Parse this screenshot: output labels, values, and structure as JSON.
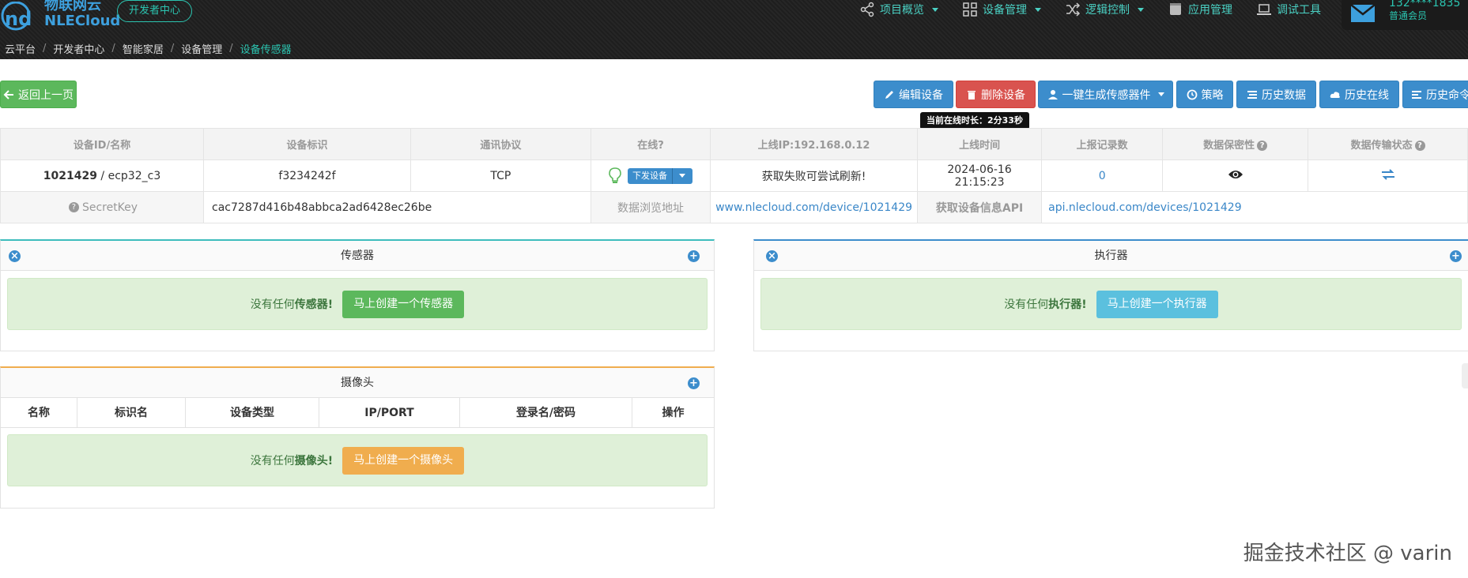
{
  "brand": {
    "name_cn": "物联网云",
    "name_en": "NLECloud",
    "dev_center": "开发者中心"
  },
  "nav": [
    {
      "label": "项目概览",
      "icon": "share-icon",
      "dropdown": true
    },
    {
      "label": "设备管理",
      "icon": "grid-icon",
      "dropdown": true
    },
    {
      "label": "逻辑控制",
      "icon": "shuffle-icon",
      "dropdown": true
    },
    {
      "label": "应用管理",
      "icon": "app-icon",
      "dropdown": false
    },
    {
      "label": "调试工具",
      "icon": "laptop-icon",
      "dropdown": false
    }
  ],
  "user": {
    "phone": "132****1835",
    "role": "普通会员"
  },
  "breadcrumb": [
    "云平台",
    "开发者中心",
    "智能家居",
    "设备管理",
    "设备传感器"
  ],
  "toolbar": {
    "back": "返回上一页",
    "edit": "编辑设备",
    "delete": "删除设备",
    "generate": "一键生成传感器件",
    "strategy": "策略",
    "history_data": "历史数据",
    "history_online": "历史在线",
    "history_cmd": "历史命令"
  },
  "tooltip": "当前在线时长：2分33秒",
  "device_table": {
    "headers": [
      "设备ID/名称",
      "设备标识",
      "通讯协议",
      "在线?",
      "上线IP:192.168.0.12",
      "上线时间",
      "上报记录数",
      "数据保密性",
      "数据传输状态"
    ],
    "device_id": "1021429",
    "device_name_sep": " / ",
    "device_name": "ecp32_c3",
    "device_tag": "f3234242f",
    "protocol": "TCP",
    "send_device": "下发设备",
    "ip_status": "获取失败可尝试刷新!",
    "online_time": "2024-06-16 21:15:23",
    "record_count": "0",
    "secret_label": "SecretKey",
    "secret_value": "cac7287d416b48abbca2ad6428ec26be",
    "browse_label": "数据浏览地址",
    "browse_url": "www.nlecloud.com/device/1021429",
    "api_label": "获取设备信息API",
    "api_url": "api.nlecloud.com/devices/1021429"
  },
  "sensor_panel": {
    "title": "传感器",
    "empty_prefix": "没有任何",
    "empty_bold": "传感器!",
    "create": "马上创建一个传感器"
  },
  "actuator_panel": {
    "title": "执行器",
    "empty_prefix": "没有任何",
    "empty_bold": "执行器!",
    "create": "马上创建一个执行器"
  },
  "camera_panel": {
    "title": "摄像头",
    "columns": [
      "名称",
      "标识名",
      "设备类型",
      "IP/PORT",
      "登录名/密码",
      "操作"
    ],
    "empty_prefix": "没有任何",
    "empty_bold": "摄像头!",
    "create": "马上创建一个摄像头"
  },
  "watermark": "掘金技术社区 @ varin",
  "colors": {
    "accent_teal": "#2bc4b0",
    "primary_blue": "#3c8dcc",
    "success_green": "#5cb85c",
    "danger_red": "#d9534f",
    "info_cyan": "#5bc0de",
    "warning_orange": "#f0ad4e"
  }
}
